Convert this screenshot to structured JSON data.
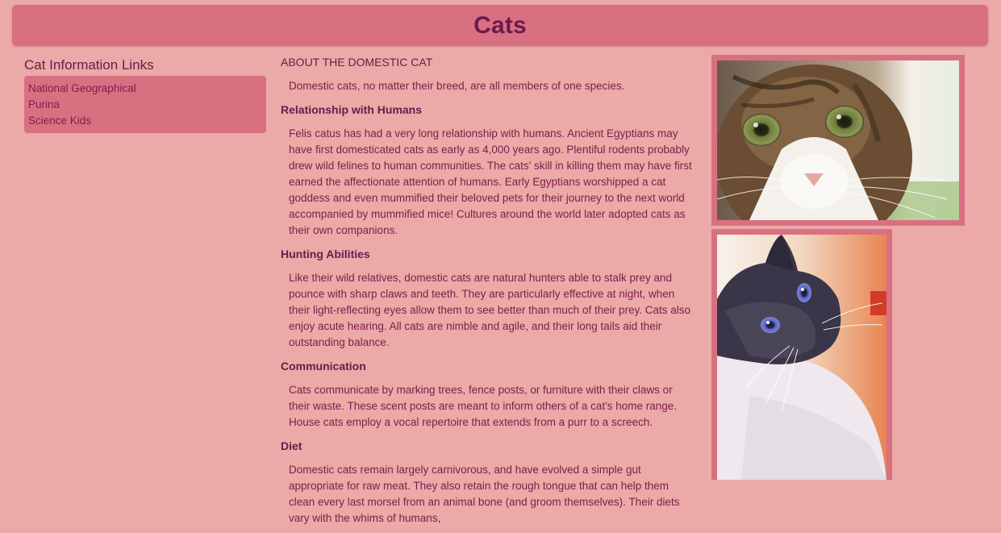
{
  "header": {
    "title": "Cats"
  },
  "sidebar": {
    "heading": "Cat Information Links",
    "links": [
      "National Geographical",
      "Purina",
      "Science Kids"
    ]
  },
  "main": {
    "sections": [
      {
        "heading": "ABOUT THE DOMESTIC CAT",
        "text": "Domestic cats, no matter their breed, are all members of one species."
      },
      {
        "heading": "Relationship with Humans",
        "text": "Felis catus has had a very long relationship with humans. Ancient Egyptians may have first domesticated cats as early as 4,000 years ago. Plentiful rodents probably drew wild felines to human communities. The cats' skill in killing them may have first earned the affectionate attention of humans. Early Egyptians worshipped a cat goddess and even mummified their beloved pets for their journey to the next world accompanied by mummified mice! Cultures around the world later adopted cats as their own companions."
      },
      {
        "heading": "Hunting Abilities",
        "text": "Like their wild relatives, domestic cats are natural hunters able to stalk prey and pounce with sharp claws and teeth. They are particularly effective at night, when their light-reflecting eyes allow them to see better than much of their prey. Cats also enjoy acute hearing. All cats are nimble and agile, and their long tails aid their outstanding balance."
      },
      {
        "heading": "Communication",
        "text": "Cats communicate by marking trees, fence posts, or furniture with their claws or their waste. These scent posts are meant to inform others of a cat's home range. House cats employ a vocal repertoire that extends from a purr to a screech."
      },
      {
        "heading": "Diet",
        "text": "Domestic cats remain largely carnivorous, and have evolved a simple gut appropriate for raw meat. They also retain the rough tongue that can help them clean every last morsel from an animal bone (and groom themselves). Their diets vary with the whims of humans,"
      }
    ]
  },
  "colors": {
    "page_background": "#eba9a7",
    "panel_pink": "#d97082",
    "text_plum": "#7a1f4a"
  }
}
